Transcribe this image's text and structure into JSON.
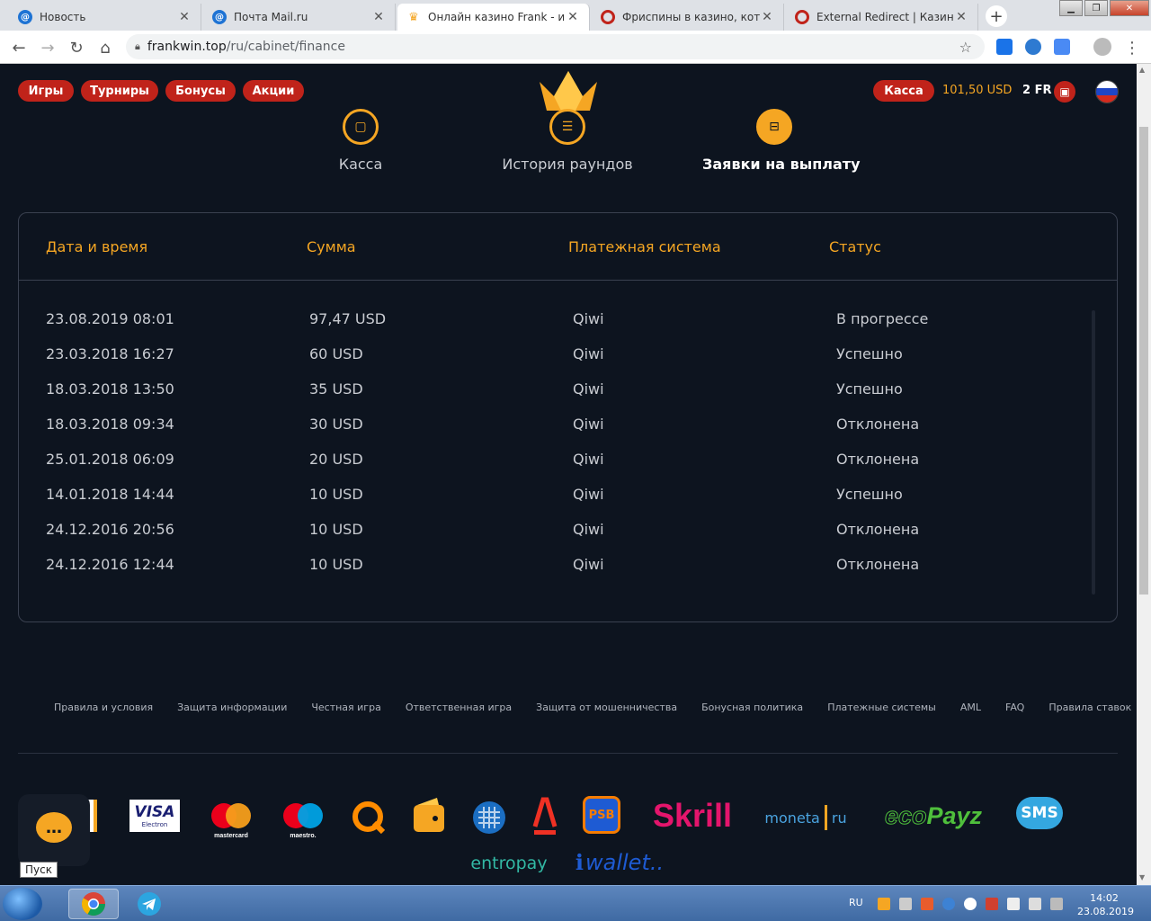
{
  "browser": {
    "tabs": [
      {
        "title": "Новость",
        "active": false
      },
      {
        "title": "Почта Mail.ru",
        "active": false
      },
      {
        "title": "Онлайн казино Frank - игра",
        "active": true
      },
      {
        "title": "Фриспины в казино, котор",
        "active": false
      },
      {
        "title": "External Redirect | Казино ф",
        "active": false
      }
    ],
    "new_tab_label": "+",
    "url_host": "frankwin.top",
    "url_path": "/ru/cabinet/finance"
  },
  "header": {
    "nav": [
      "Игры",
      "Турниры",
      "Бонусы",
      "Акции"
    ],
    "cashier_button": "Касса",
    "balance": "101,50 USD",
    "freespins": "2 FR"
  },
  "subnav": {
    "items": [
      {
        "label": "Касса",
        "active": false
      },
      {
        "label": "История раундов",
        "active": false
      },
      {
        "label": "Заявки на выплату",
        "active": true
      }
    ]
  },
  "table": {
    "columns": [
      "Дата и время",
      "Сумма",
      "Платежная система",
      "Статус"
    ],
    "rows": [
      {
        "date": "23.08.2019 08:01",
        "amount": "97,47 USD",
        "system": "Qiwi",
        "status": "В прогрессе"
      },
      {
        "date": "23.03.2018 16:27",
        "amount": "60 USD",
        "system": "Qiwi",
        "status": "Успешно"
      },
      {
        "date": "18.03.2018 13:50",
        "amount": "35 USD",
        "system": "Qiwi",
        "status": "Успешно"
      },
      {
        "date": "18.03.2018 09:34",
        "amount": "30 USD",
        "system": "Qiwi",
        "status": "Отклонена"
      },
      {
        "date": "25.01.2018 06:09",
        "amount": "20 USD",
        "system": "Qiwi",
        "status": "Отклонена"
      },
      {
        "date": "14.01.2018 14:44",
        "amount": "10 USD",
        "system": "Qiwi",
        "status": "Успешно"
      },
      {
        "date": "24.12.2016 20:56",
        "amount": "10 USD",
        "system": "Qiwi",
        "status": "Отклонена"
      },
      {
        "date": "24.12.2016 12:44",
        "amount": "10 USD",
        "system": "Qiwi",
        "status": "Отклонена"
      }
    ]
  },
  "footer": {
    "links": [
      "Правила и условия",
      "Защита информации",
      "Честная игра",
      "Ответственная игра",
      "Защита от мошенничества",
      "Бонусная политика",
      "Платежные системы",
      "AML",
      "FAQ",
      "Правила ставок"
    ],
    "payment_logos": {
      "visa": "VISA",
      "visa_sub": "Electron",
      "mastercard": "mastercard",
      "maestro": "maestro.",
      "psb": "PSB",
      "skrill": "Skrill",
      "moneta": "moneta",
      "moneta_ru": "ru",
      "ecopayz_eco": "eco",
      "ecopayz_payz": "Payz",
      "sms": "SMS",
      "entropay": "entropay",
      "wallet": "wallet.."
    }
  },
  "chat": {
    "tooltip": "Пуск"
  },
  "taskbar": {
    "lang": "RU",
    "time": "14:02",
    "date": "23.08.2019"
  }
}
